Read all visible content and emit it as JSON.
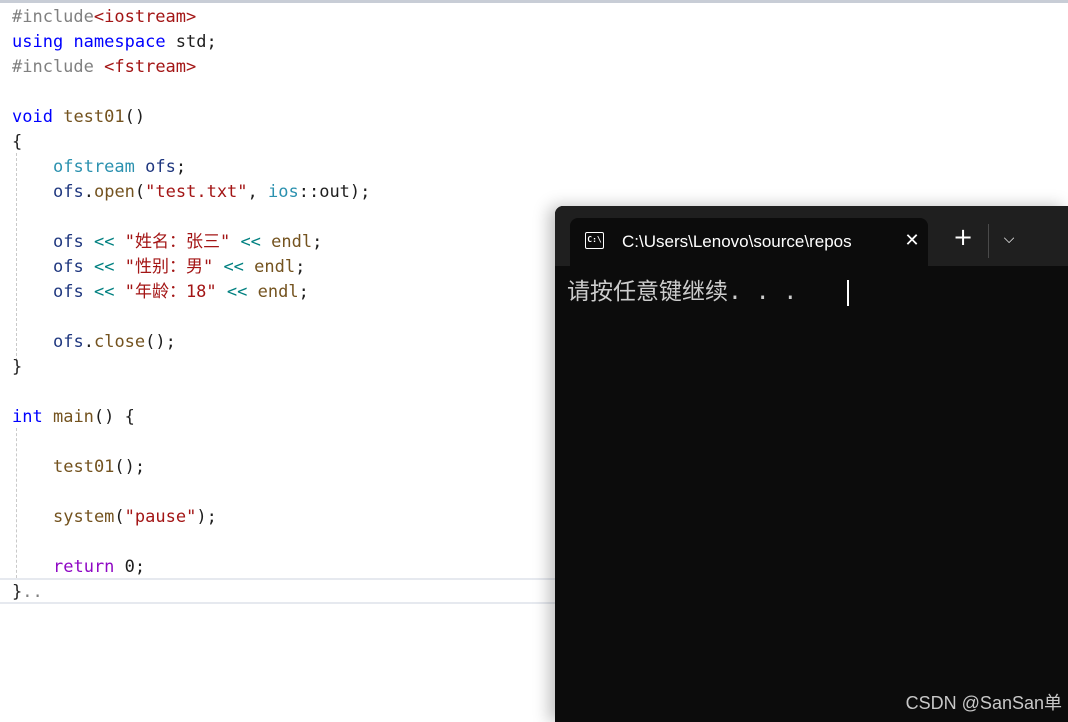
{
  "editor": {
    "lines": [
      {
        "tokens": [
          {
            "t": "#include",
            "k": "pp"
          },
          {
            "t": "<iostream>",
            "k": "inc"
          }
        ]
      },
      {
        "tokens": [
          {
            "t": "using",
            "k": "kw"
          },
          {
            "t": " ",
            "k": "plain"
          },
          {
            "t": "namespace",
            "k": "kw"
          },
          {
            "t": " std;",
            "k": "plain"
          }
        ]
      },
      {
        "tokens": [
          {
            "t": "#include",
            "k": "pp"
          },
          {
            "t": " ",
            "k": "plain"
          },
          {
            "t": "<fstream>",
            "k": "inc"
          }
        ]
      },
      {
        "tokens": []
      },
      {
        "tokens": [
          {
            "t": "void",
            "k": "kw"
          },
          {
            "t": " ",
            "k": "plain"
          },
          {
            "t": "test01",
            "k": "fn"
          },
          {
            "t": "()",
            "k": "plain"
          }
        ]
      },
      {
        "tokens": [
          {
            "t": "{",
            "k": "plain"
          }
        ]
      },
      {
        "indent": true,
        "tokens": [
          {
            "t": "ofstream",
            "k": "type"
          },
          {
            "t": " ",
            "k": "plain"
          },
          {
            "t": "ofs",
            "k": "var"
          },
          {
            "t": ";",
            "k": "plain"
          }
        ]
      },
      {
        "indent": true,
        "tokens": [
          {
            "t": "ofs",
            "k": "var"
          },
          {
            "t": ".",
            "k": "plain"
          },
          {
            "t": "open",
            "k": "fn"
          },
          {
            "t": "(",
            "k": "plain"
          },
          {
            "t": "\"test.txt\"",
            "k": "str"
          },
          {
            "t": ", ",
            "k": "plain"
          },
          {
            "t": "ios",
            "k": "type"
          },
          {
            "t": "::out);",
            "k": "plain"
          }
        ]
      },
      {
        "tokens": []
      },
      {
        "indent": true,
        "tokens": [
          {
            "t": "ofs",
            "k": "var"
          },
          {
            "t": " ",
            "k": "plain"
          },
          {
            "t": "<<",
            "k": "op"
          },
          {
            "t": " ",
            "k": "plain"
          },
          {
            "t": "\"姓名：张三\"",
            "k": "str"
          },
          {
            "t": " ",
            "k": "plain"
          },
          {
            "t": "<<",
            "k": "op"
          },
          {
            "t": " ",
            "k": "plain"
          },
          {
            "t": "endl",
            "k": "fn"
          },
          {
            "t": ";",
            "k": "plain"
          }
        ]
      },
      {
        "indent": true,
        "tokens": [
          {
            "t": "ofs",
            "k": "var"
          },
          {
            "t": " ",
            "k": "plain"
          },
          {
            "t": "<<",
            "k": "op"
          },
          {
            "t": " ",
            "k": "plain"
          },
          {
            "t": "\"性别：男\"",
            "k": "str"
          },
          {
            "t": " ",
            "k": "plain"
          },
          {
            "t": "<<",
            "k": "op"
          },
          {
            "t": " ",
            "k": "plain"
          },
          {
            "t": "endl",
            "k": "fn"
          },
          {
            "t": ";",
            "k": "plain"
          }
        ]
      },
      {
        "indent": true,
        "tokens": [
          {
            "t": "ofs",
            "k": "var"
          },
          {
            "t": " ",
            "k": "plain"
          },
          {
            "t": "<<",
            "k": "op"
          },
          {
            "t": " ",
            "k": "plain"
          },
          {
            "t": "\"年龄：18\"",
            "k": "str"
          },
          {
            "t": " ",
            "k": "plain"
          },
          {
            "t": "<<",
            "k": "op"
          },
          {
            "t": " ",
            "k": "plain"
          },
          {
            "t": "endl",
            "k": "fn"
          },
          {
            "t": ";",
            "k": "plain"
          }
        ]
      },
      {
        "tokens": []
      },
      {
        "indent": true,
        "tokens": [
          {
            "t": "ofs",
            "k": "var"
          },
          {
            "t": ".",
            "k": "plain"
          },
          {
            "t": "close",
            "k": "fn"
          },
          {
            "t": "();",
            "k": "plain"
          }
        ]
      },
      {
        "tokens": [
          {
            "t": "}",
            "k": "plain"
          }
        ]
      },
      {
        "tokens": []
      },
      {
        "tokens": [
          {
            "t": "int",
            "k": "kw"
          },
          {
            "t": " ",
            "k": "plain"
          },
          {
            "t": "main",
            "k": "fn"
          },
          {
            "t": "() {",
            "k": "plain"
          }
        ]
      },
      {
        "tokens": []
      },
      {
        "indent": true,
        "tokens": [
          {
            "t": "test01",
            "k": "fn"
          },
          {
            "t": "();",
            "k": "plain"
          }
        ]
      },
      {
        "tokens": []
      },
      {
        "indent": true,
        "tokens": [
          {
            "t": "system",
            "k": "fn"
          },
          {
            "t": "(",
            "k": "plain"
          },
          {
            "t": "\"pause\"",
            "k": "str"
          },
          {
            "t": ");",
            "k": "plain"
          }
        ]
      },
      {
        "tokens": []
      },
      {
        "indent": true,
        "tokens": [
          {
            "t": "return",
            "k": "kw2"
          },
          {
            "t": " 0;",
            "k": "plain"
          }
        ]
      },
      {
        "tokens": [
          {
            "t": "}",
            "k": "plain"
          },
          {
            "t": "..",
            "k": "pp"
          }
        ]
      }
    ],
    "colors": {
      "pp": "#808080",
      "inc": "#a31515",
      "kw": "#0000ff",
      "kw2": "#8f08c4",
      "type": "#2b91af",
      "var": "#1f377f",
      "fn": "#74531f",
      "str": "#a31515",
      "op": "#008080",
      "plain": "#1e1e1e"
    }
  },
  "terminal": {
    "tab_icon": "cmd-icon",
    "tab_icon_text": "C:\\",
    "tab_title": "C:\\Users\\Lenovo\\source\\repos",
    "close_glyph": "✕",
    "new_tab_glyph": "+",
    "dropdown_glyph": "⌵",
    "output": "请按任意键继续. . .",
    "background": "#0c0c0c"
  },
  "watermark": "CSDN @SanSan单"
}
